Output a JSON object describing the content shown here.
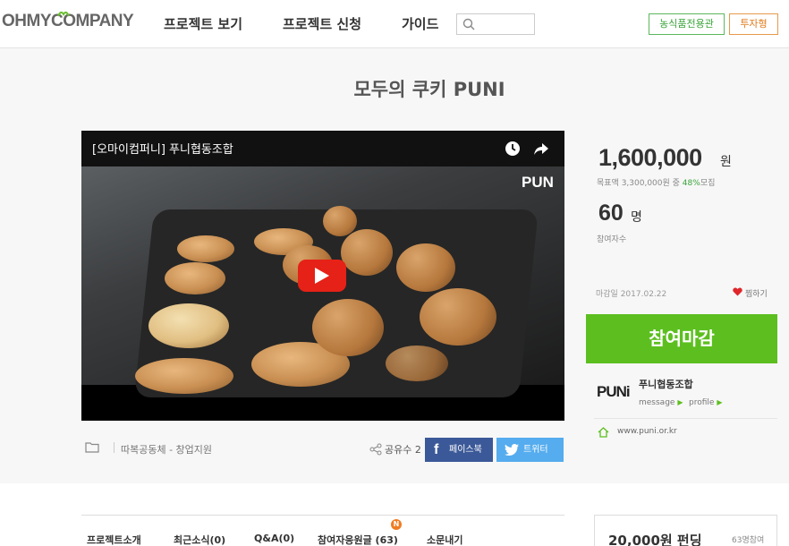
{
  "header": {
    "logo": "OHMYCOMPANY",
    "nav": [
      "프로젝트 보기",
      "프로젝트 신청",
      "가이드"
    ],
    "search_placeholder": "",
    "button_green": "농식품전용관",
    "button_orange": "투자형"
  },
  "project": {
    "title": "모두의 쿠키 PUNI"
  },
  "video": {
    "title": "[오마이컴퍼니] 푸니협동조합",
    "watermark": "PUN"
  },
  "meta": {
    "category": "따복공동체 - 창업지원",
    "share_count_label": "공유수 2",
    "facebook_label": "페이스북",
    "twitter_label": "트위터"
  },
  "stats": {
    "amount": "1,600,000",
    "amount_unit": "원",
    "goal_text": "목표액 3,300,000원 중 ",
    "goal_pct": "48%",
    "goal_suffix": "모집",
    "participants": "60",
    "participants_unit": "명",
    "participants_label": "참여자수",
    "deadline": "마감일 2017.02.22",
    "wish_label": "찜하기",
    "cta_label": "참여마감"
  },
  "creator": {
    "logo_text": "PUNi",
    "name": "푸니협동조합",
    "message_label": "message",
    "profile_label": "profile",
    "website": "www.puni.or.kr"
  },
  "tabs": [
    "프로젝트소개",
    "최근소식(0)",
    "Q&A(0)",
    "참여자응원글 (63)",
    "소문내기"
  ],
  "new_badge": "N",
  "reward": {
    "amount": "20,000원 펀딩",
    "people": "63명참여"
  },
  "colors": {
    "accent_green": "#5cbf1f",
    "facebook": "#3b5998",
    "twitter": "#55acee",
    "youtube_red": "#e62117"
  }
}
